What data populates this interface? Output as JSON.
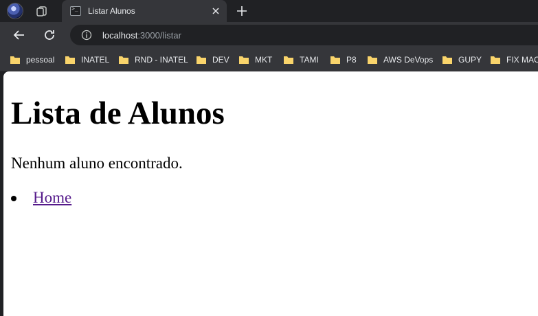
{
  "tab": {
    "title": "Listar Alunos"
  },
  "address_bar": {
    "host": "localhost",
    "path": ":3000/listar"
  },
  "bookmarks": [
    "pessoal",
    "INATEL",
    "RND - INATEL",
    "DEV",
    "MKT",
    "TAMI",
    "P8",
    "AWS DeVops",
    "GUPY",
    "FIX MAC"
  ],
  "page": {
    "heading": "Lista de Alunos",
    "message": "Nenhum aluno encontrado.",
    "links": [
      "Home"
    ]
  },
  "colors": {
    "chrome_dark": "#202124",
    "chrome": "#35363a",
    "folder": "#f9d46b",
    "visited_link": "#551a8b"
  }
}
